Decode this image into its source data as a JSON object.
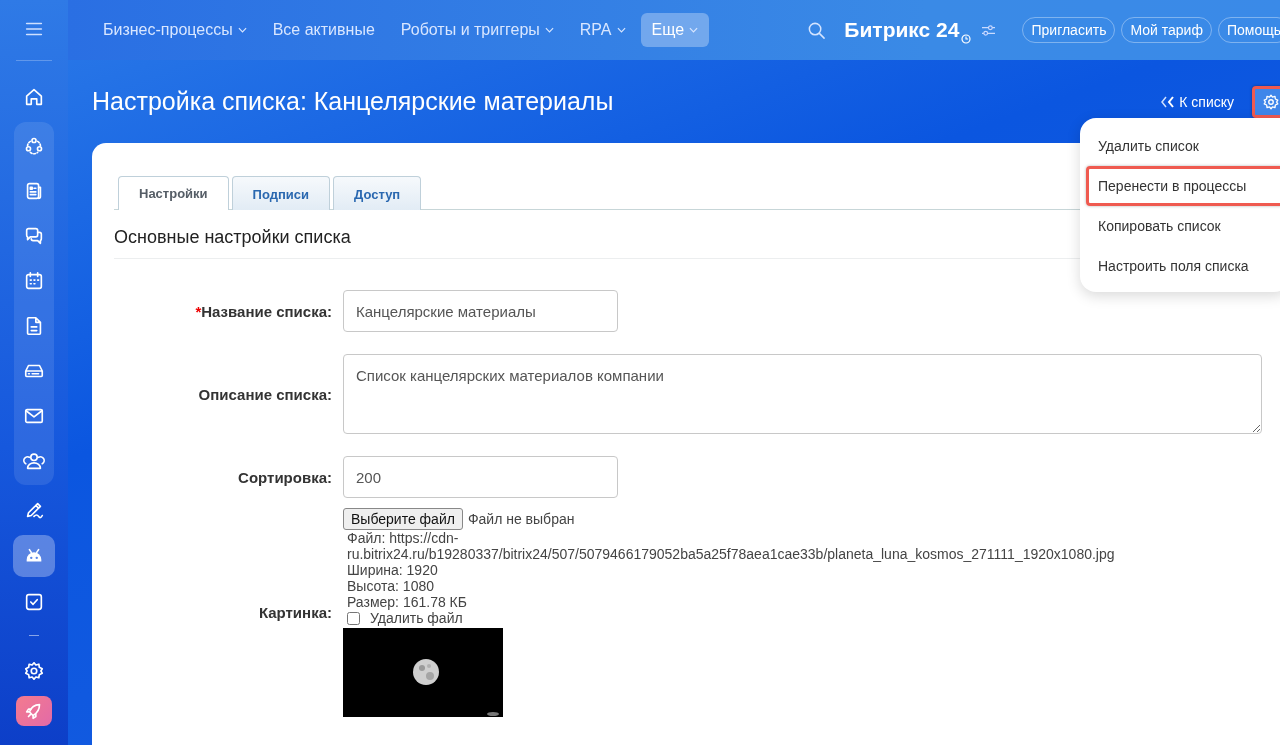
{
  "sidebar": {
    "top_items": [
      {
        "kind": "home",
        "selected": false
      }
    ],
    "group_items": [
      {
        "kind": "flow",
        "selected": false
      },
      {
        "kind": "feed",
        "selected": false
      },
      {
        "kind": "chat",
        "selected": false
      },
      {
        "kind": "calendar",
        "selected": false
      },
      {
        "kind": "document",
        "selected": false
      },
      {
        "kind": "drive",
        "selected": false
      },
      {
        "kind": "mail",
        "selected": false
      },
      {
        "kind": "contacts",
        "selected": false
      }
    ],
    "bottom_items": [
      {
        "kind": "sign",
        "selected": false
      },
      {
        "kind": "robot",
        "selected": true
      },
      {
        "kind": "tasks",
        "selected": false
      }
    ],
    "footer_items": [
      {
        "kind": "settings",
        "selected": false
      },
      {
        "kind": "rocket",
        "selected": false
      }
    ]
  },
  "top_nav": {
    "items": [
      {
        "label": "Бизнес-процессы",
        "dropdown": true,
        "selected": false
      },
      {
        "label": "Все активные",
        "dropdown": false,
        "selected": false
      },
      {
        "label": "Роботы и триггеры",
        "dropdown": true,
        "selected": false
      },
      {
        "label": "RPA",
        "dropdown": true,
        "selected": false
      },
      {
        "label": "Еще",
        "dropdown": true,
        "selected": true
      }
    ],
    "logo": "Битрикс 24",
    "buttons": [
      "Пригласить",
      "Мой тариф",
      "Помощь"
    ]
  },
  "page": {
    "title": "Настройка списка: Канцелярские материалы",
    "back_link": "К списку",
    "settings_highlighted": true
  },
  "menu": {
    "items": [
      {
        "label": "Удалить список",
        "highlighted": false
      },
      {
        "label": "Перенести в процессы",
        "highlighted": true
      },
      {
        "label": "Копировать список",
        "highlighted": false
      },
      {
        "label": "Настроить поля списка",
        "highlighted": false
      }
    ]
  },
  "tabs": [
    {
      "label": "Настройки",
      "selected": true
    },
    {
      "label": "Подписи",
      "selected": false
    },
    {
      "label": "Доступ",
      "selected": false
    }
  ],
  "section_title": "Основные настройки списка",
  "form": {
    "name": {
      "label": "Название списка:",
      "required_mark": "*",
      "value": "Канцелярские материалы"
    },
    "description": {
      "label": "Описание списка:",
      "value": "Список канцелярских материалов компании"
    },
    "sort": {
      "label": "Сортировка:",
      "value": "200"
    },
    "picture": {
      "label": "Картинка:",
      "choose_button": "Выберите файл",
      "no_file": "Файл не выбран",
      "info": [
        "Файл: https://cdn-ru.bitrix24.ru/b19280337/bitrix24/507/5079466179052ba5a25f78aea1cae33b/planeta_luna_kosmos_271111_1920x1080.jpg",
        "Ширина: 1920",
        "Высота: 1080",
        "Размер: 161.78 КБ"
      ],
      "delete_label": "Удалить файл",
      "delete_checked": false,
      "preview": {
        "kind": "picture"
      }
    }
  }
}
